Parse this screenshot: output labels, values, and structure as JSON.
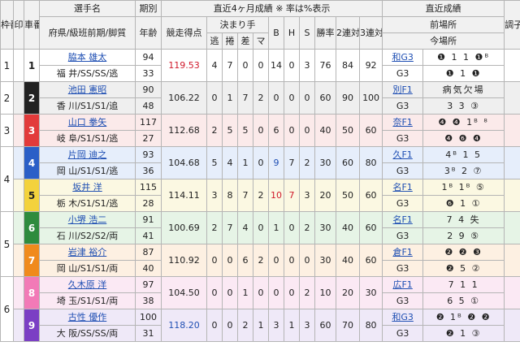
{
  "headers": {
    "waku": "枠番",
    "shirushi": "印",
    "car": "車番",
    "name_line1": "選手名",
    "name_line2": "府県/級班前期/脚質",
    "age_line1": "期別",
    "age_line2": "年齢",
    "recent": "直近4ヶ月成績 ※ 率は%表示",
    "score": "競走得点",
    "kimarite": "決まり手",
    "nige": "逃",
    "makuri": "捲",
    "sashi": "差",
    "mark": "マ",
    "b": "B",
    "h": "H",
    "s": "S",
    "win_rate": "勝率",
    "quinella_rate": "2連対率",
    "trifecta_rate": "3連対率",
    "latest": "直近成績",
    "prev_meet": "前場所",
    "this_meet": "今場所",
    "condition": "調子"
  },
  "riders": [
    {
      "waku": "1",
      "car": "1",
      "name": "脇本 雄太",
      "pref": "福 井/SS",
      "cls": "SS/逃",
      "period": "94",
      "age": "33",
      "score": "119.53",
      "score_color": "red",
      "n": "4",
      "m": "7",
      "sa": "0",
      "ma": "0",
      "b": "14",
      "h": "0",
      "s": "3",
      "win": "76",
      "quin": "84",
      "tri": "92",
      "prev": "和G3",
      "prev_res": "❶ 1 1 ❶ᴮ",
      "now_grade": "G3",
      "now_res": "❶ 1 ❶",
      "cond": ""
    },
    {
      "waku": "2",
      "car": "2",
      "name": "池田 憲昭",
      "pref": "香 川/S1",
      "cls": "S1/追",
      "period": "90",
      "age": "48",
      "score": "106.22",
      "score_color": "",
      "n": "0",
      "m": "1",
      "sa": "7",
      "ma": "2",
      "b": "0",
      "h": "0",
      "s": "0",
      "win": "60",
      "quin": "90",
      "tri": "100",
      "prev": "別F1",
      "prev_res": "病気欠場",
      "now_grade": "G3",
      "now_res": "3 3 ③",
      "cond": ""
    },
    {
      "waku": "3",
      "car": "3",
      "name": "山口 拳矢",
      "pref": "岐 阜/S1",
      "cls": "S1/逃",
      "period": "117",
      "age": "27",
      "score": "112.68",
      "score_color": "",
      "n": "2",
      "m": "5",
      "sa": "5",
      "ma": "0",
      "b": "6",
      "h": "0",
      "s": "0",
      "win": "40",
      "quin": "50",
      "tri": "60",
      "prev": "奈F1",
      "prev_res": "❹ ❹ 1ᴮ ⁸",
      "now_grade": "G3",
      "now_res": "❹ ❻ ❹",
      "cond": ""
    },
    {
      "waku": "4",
      "car": "4",
      "name": "片岡 迪之",
      "pref": "岡 山/S1",
      "cls": "S1/逃",
      "period": "93",
      "age": "36",
      "score": "104.68",
      "score_color": "",
      "n": "5",
      "m": "4",
      "sa": "1",
      "ma": "0",
      "b": "9",
      "h": "7",
      "s": "2",
      "win": "30",
      "quin": "60",
      "tri": "80",
      "prev": "久F1",
      "prev_res": "4ᴮ 1 5",
      "now_grade": "G3",
      "now_res": "3ᴮ 2 ⑦",
      "cond": ""
    },
    {
      "waku": "4",
      "car": "5",
      "name": "坂井 洋",
      "pref": "栃 木/S1",
      "cls": "S1/逃",
      "period": "115",
      "age": "28",
      "score": "114.11",
      "score_color": "",
      "n": "3",
      "m": "8",
      "sa": "7",
      "ma": "2",
      "b": "10",
      "h": "7",
      "s": "3",
      "win": "20",
      "quin": "50",
      "tri": "60",
      "prev": "名F1",
      "prev_res": "1ᴮ 1ᴮ ⑤",
      "now_grade": "G3",
      "now_res": "❻ 1 ①",
      "cond": ""
    },
    {
      "waku": "5",
      "car": "6",
      "name": "小堺 浩二",
      "pref": "石 川/S2",
      "cls": "S2/両",
      "period": "91",
      "age": "41",
      "score": "100.69",
      "score_color": "",
      "n": "2",
      "m": "7",
      "sa": "4",
      "ma": "0",
      "b": "1",
      "h": "0",
      "s": "2",
      "win": "30",
      "quin": "40",
      "tri": "60",
      "prev": "名F1",
      "prev_res": "7 4 失",
      "now_grade": "G3",
      "now_res": "2 9 ⑤",
      "cond": ""
    },
    {
      "waku": "5",
      "car": "7",
      "name": "岩津 裕介",
      "pref": "岡 山/S1",
      "cls": "S1/両",
      "period": "87",
      "age": "40",
      "score": "110.92",
      "score_color": "",
      "n": "0",
      "m": "0",
      "sa": "6",
      "ma": "2",
      "b": "0",
      "h": "0",
      "s": "0",
      "win": "30",
      "quin": "40",
      "tri": "60",
      "prev": "倉F1",
      "prev_res": "❷ ❷ ❸",
      "now_grade": "G3",
      "now_res": "❷ 5 ②",
      "cond": ""
    },
    {
      "waku": "6",
      "car": "8",
      "name": "久木原 洋",
      "pref": "埼 玉/S1",
      "cls": "S1/両",
      "period": "97",
      "age": "38",
      "score": "104.50",
      "score_color": "",
      "n": "0",
      "m": "0",
      "sa": "1",
      "ma": "0",
      "b": "0",
      "h": "0",
      "s": "2",
      "win": "10",
      "quin": "20",
      "tri": "30",
      "prev": "広F1",
      "prev_res": "7 1 1",
      "now_grade": "G3",
      "now_res": "6 5 ①",
      "cond": ""
    },
    {
      "waku": "6",
      "car": "9",
      "name": "古性 優作",
      "pref": "大 阪/SS",
      "cls": "SS/両",
      "period": "100",
      "age": "31",
      "score": "118.20",
      "score_color": "blue",
      "n": "0",
      "m": "0",
      "sa": "2",
      "ma": "1",
      "b": "3",
      "h": "1",
      "s": "3",
      "win": "60",
      "quin": "70",
      "tri": "80",
      "prev": "和G3",
      "prev_res": "❷ 1ᴮ ❷ ❷",
      "now_grade": "G3",
      "now_res": "❷ 1 ③",
      "cond": ""
    }
  ]
}
